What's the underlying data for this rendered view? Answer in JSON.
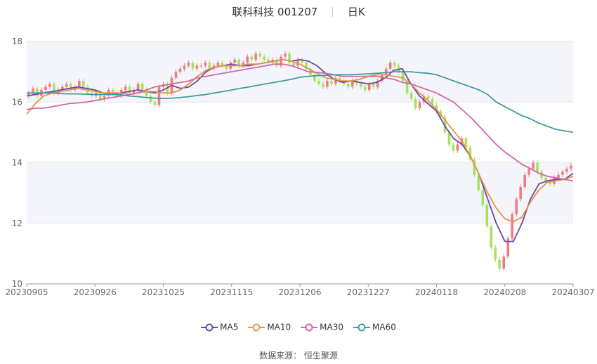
{
  "header": {
    "name_code": "联科科技 001207",
    "period": "日K"
  },
  "source": {
    "label": "数据来源：",
    "value": "恒生聚源"
  },
  "chart_data": {
    "type": "candlestick",
    "ylim": [
      10,
      18
    ],
    "yticks": [
      10,
      12,
      14,
      16,
      18
    ],
    "xticks": [
      "20230905",
      "20230926",
      "20231025",
      "20231115",
      "20231206",
      "20231227",
      "20240118",
      "20240208",
      "20240307"
    ],
    "grid": true,
    "legend_position": "bottom",
    "colors": {
      "up": "#f07c82",
      "down": "#a8e05f",
      "MA5": "#6b46a8",
      "MA10": "#e39547",
      "MA30": "#d466a6",
      "MA60": "#3f9c9c"
    },
    "candles": [
      16.3,
      16.45,
      16.2,
      16.4,
      16.5,
      16.6,
      16.3,
      16.4,
      16.5,
      16.6,
      16.4,
      16.5,
      16.7,
      16.5,
      16.3,
      16.2,
      16.3,
      16.1,
      16.2,
      16.4,
      16.3,
      16.2,
      16.4,
      16.5,
      16.3,
      16.4,
      16.6,
      16.4,
      16.2,
      16.0,
      15.9,
      16.5,
      16.6,
      16.3,
      16.8,
      17.0,
      17.1,
      17.2,
      17.3,
      17.1,
      17.2,
      17.2,
      17.3,
      17.1,
      17.2,
      17.3,
      17.2,
      17.1,
      17.3,
      17.4,
      17.2,
      17.3,
      17.5,
      17.4,
      17.6,
      17.5,
      17.4,
      17.3,
      17.4,
      17.2,
      17.5,
      17.6,
      17.3,
      17.2,
      17.4,
      17.3,
      17.1,
      16.9,
      16.7,
      16.6,
      16.5,
      16.7,
      16.6,
      16.8,
      16.7,
      16.6,
      16.5,
      16.7,
      16.6,
      16.5,
      16.4,
      16.6,
      16.5,
      16.7,
      16.9,
      17.1,
      17.3,
      17.2,
      17.0,
      16.7,
      16.3,
      16.1,
      15.8,
      16.0,
      16.2,
      16.1,
      15.9,
      15.7,
      15.5,
      15.0,
      14.6,
      14.4,
      14.6,
      14.8,
      14.5,
      14.1,
      13.6,
      13.1,
      12.6,
      11.9,
      11.2,
      10.8,
      10.5,
      10.9,
      11.5,
      12.3,
      12.8,
      13.2,
      13.6,
      13.8,
      14.0,
      13.7,
      13.5,
      13.4,
      13.3,
      13.5,
      13.6,
      13.7,
      13.8,
      13.9
    ],
    "series": [
      {
        "name": "MA5",
        "values": [
          16.2,
          16.25,
          16.3,
          16.35,
          16.4,
          16.45,
          16.5,
          16.45,
          16.4,
          16.3,
          16.25,
          16.3,
          16.35,
          16.4,
          16.35,
          16.3,
          16.4,
          16.55,
          16.45,
          16.5,
          16.7,
          17.0,
          17.15,
          17.2,
          17.25,
          17.2,
          17.2,
          17.25,
          17.3,
          17.35,
          17.4,
          17.35,
          17.4,
          17.35,
          17.2,
          16.95,
          16.75,
          16.65,
          16.7,
          16.65,
          16.6,
          16.65,
          16.8,
          17.05,
          17.1,
          16.6,
          16.2,
          15.95,
          15.7,
          15.2,
          14.8,
          14.6,
          14.2,
          13.6,
          12.8,
          12.0,
          11.4,
          11.4,
          12.0,
          12.8,
          13.3,
          13.4,
          13.45,
          13.45,
          13.65
        ]
      },
      {
        "name": "MA10",
        "values": [
          15.6,
          15.95,
          16.2,
          16.3,
          16.35,
          16.4,
          16.45,
          16.4,
          16.35,
          16.3,
          16.3,
          16.3,
          16.25,
          16.3,
          16.35,
          16.35,
          16.3,
          16.3,
          16.4,
          16.6,
          16.85,
          17.05,
          17.15,
          17.2,
          17.2,
          17.2,
          17.25,
          17.25,
          17.3,
          17.35,
          17.4,
          17.35,
          17.25,
          17.1,
          16.95,
          16.8,
          16.75,
          16.7,
          16.7,
          16.75,
          16.85,
          16.9,
          16.9,
          16.85,
          16.8,
          16.6,
          16.3,
          16.05,
          15.75,
          15.4,
          15.05,
          14.7,
          14.2,
          13.6,
          13.0,
          12.5,
          12.15,
          12.05,
          12.2,
          12.7,
          13.1,
          13.35,
          13.4,
          13.45,
          13.55
        ]
      },
      {
        "name": "MA30",
        "values": [
          15.75,
          15.8,
          15.8,
          15.85,
          15.9,
          15.95,
          15.97,
          16.0,
          16.05,
          16.1,
          16.15,
          16.2,
          16.25,
          16.3,
          16.4,
          16.5,
          16.55,
          16.6,
          16.65,
          16.7,
          16.8,
          16.85,
          16.9,
          16.95,
          17.0,
          17.05,
          17.1,
          17.15,
          17.2,
          17.25,
          17.25,
          17.2,
          17.1,
          17.0,
          16.98,
          16.95,
          16.9,
          16.85,
          16.85,
          16.85,
          16.85,
          16.85,
          16.8,
          16.75,
          16.65,
          16.6,
          16.5,
          16.4,
          16.3,
          16.15,
          16.0,
          15.75,
          15.5,
          15.2,
          14.9,
          14.6,
          14.35,
          14.15,
          13.95,
          13.8,
          13.65,
          13.55,
          13.5,
          13.45,
          13.4
        ]
      },
      {
        "name": "MA60",
        "values": [
          16.3,
          16.3,
          16.3,
          16.3,
          16.28,
          16.27,
          16.27,
          16.26,
          16.25,
          16.25,
          16.25,
          16.24,
          16.2,
          16.18,
          16.15,
          16.13,
          16.12,
          16.13,
          16.15,
          16.18,
          16.22,
          16.25,
          16.3,
          16.35,
          16.4,
          16.45,
          16.5,
          16.55,
          16.6,
          16.65,
          16.7,
          16.75,
          16.82,
          16.85,
          16.87,
          16.88,
          16.9,
          16.9,
          16.9,
          16.92,
          16.93,
          16.95,
          16.97,
          17.0,
          17.0,
          17.0,
          16.97,
          16.95,
          16.9,
          16.8,
          16.7,
          16.6,
          16.5,
          16.4,
          16.25,
          16.0,
          15.85,
          15.7,
          15.55,
          15.45,
          15.3,
          15.2,
          15.1,
          15.05,
          15.0
        ]
      }
    ]
  }
}
